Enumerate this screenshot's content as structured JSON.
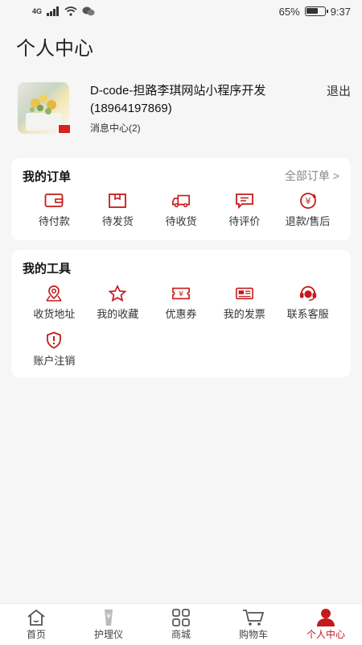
{
  "status_bar": {
    "signal": "4G",
    "battery": "65%",
    "time": "9:37"
  },
  "page_title": "个人中心",
  "profile": {
    "name": "D-code-担路李琪网站小程序开发(18964197869)",
    "message_center": "消息中心(2)",
    "logout": "退出"
  },
  "orders": {
    "title": "我的订单",
    "all_link": "全部订单 >",
    "items": [
      {
        "label": "待付款",
        "icon": "wallet-icon"
      },
      {
        "label": "待发货",
        "icon": "package-icon"
      },
      {
        "label": "待收货",
        "icon": "truck-icon"
      },
      {
        "label": "待评价",
        "icon": "comment-icon"
      },
      {
        "label": "退款/售后",
        "icon": "refund-icon"
      }
    ]
  },
  "tools": {
    "title": "我的工具",
    "items": [
      {
        "label": "收货地址",
        "icon": "location-icon"
      },
      {
        "label": "我的收藏",
        "icon": "star-icon"
      },
      {
        "label": "优惠券",
        "icon": "coupon-icon"
      },
      {
        "label": "我的发票",
        "icon": "invoice-icon"
      },
      {
        "label": "联系客服",
        "icon": "headset-icon"
      },
      {
        "label": "账户注销",
        "icon": "warning-shield-icon"
      }
    ]
  },
  "tabbar": {
    "items": [
      {
        "label": "首页",
        "icon": "home-icon"
      },
      {
        "label": "护理仪",
        "icon": "device-icon"
      },
      {
        "label": "商城",
        "icon": "grid-icon"
      },
      {
        "label": "购物车",
        "icon": "cart-icon"
      },
      {
        "label": "个人中心",
        "icon": "user-icon"
      }
    ],
    "active_index": 4
  },
  "colors": {
    "accent": "#c51a1a",
    "background": "#f6f6f6"
  }
}
